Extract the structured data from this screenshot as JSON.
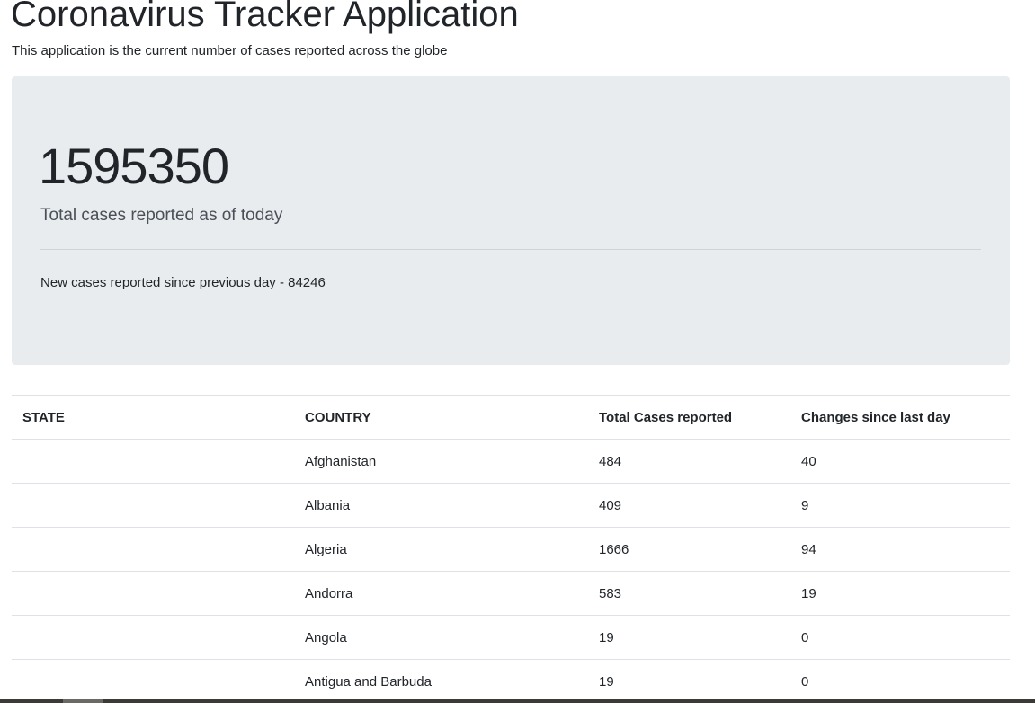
{
  "header": {
    "title": "Coronavirus Tracker Application",
    "subtitle": "This application is the current number of cases reported across the globe"
  },
  "summary": {
    "total_cases": "1595350",
    "total_label": "Total cases reported as of today",
    "new_cases_text": "New cases reported since previous day - 84246"
  },
  "table": {
    "headers": [
      "STATE",
      "COUNTRY",
      "Total Cases reported",
      "Changes since last day"
    ],
    "rows": [
      {
        "state": "",
        "country": "Afghanistan",
        "total": "484",
        "change": "40"
      },
      {
        "state": "",
        "country": "Albania",
        "total": "409",
        "change": "9"
      },
      {
        "state": "",
        "country": "Algeria",
        "total": "1666",
        "change": "94"
      },
      {
        "state": "",
        "country": "Andorra",
        "total": "583",
        "change": "19"
      },
      {
        "state": "",
        "country": "Angola",
        "total": "19",
        "change": "0"
      },
      {
        "state": "",
        "country": "Antigua and Barbuda",
        "total": "19",
        "change": "0"
      }
    ]
  }
}
